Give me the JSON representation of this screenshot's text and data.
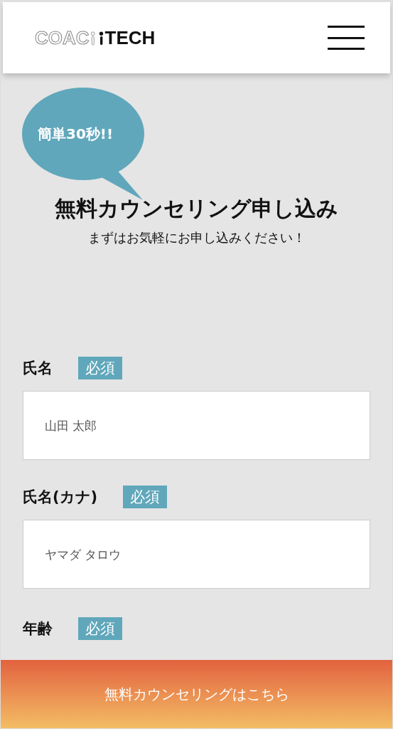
{
  "header": {
    "logo": {
      "outline": "COAC",
      "solid": "TECH"
    }
  },
  "hero": {
    "badge": "簡単30秒!!",
    "title": "無料カウンセリング申し込み",
    "subtitle": "まずはお気軽にお申し込みください！"
  },
  "form": {
    "fields": [
      {
        "label": "氏名",
        "required_tag": "必須",
        "placeholder": "山田 太郎"
      },
      {
        "label": "氏名(カナ)",
        "required_tag": "必須",
        "placeholder": "ヤマダ タロウ"
      },
      {
        "label": "年齢",
        "required_tag": "必須"
      }
    ]
  },
  "cta_button": "無料カウンセリングはこちら"
}
